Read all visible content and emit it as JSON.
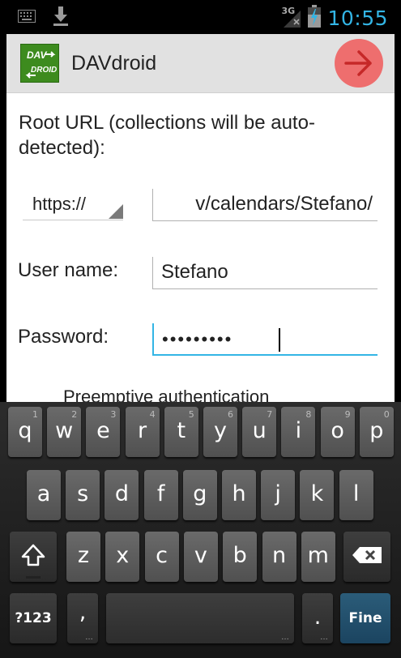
{
  "status_bar": {
    "network_type": "3G",
    "time": "10:55",
    "icons": [
      "keyboard-icon",
      "download-icon",
      "signal-icon",
      "battery-charging-icon"
    ]
  },
  "action_bar": {
    "logo_text_top": "DAV",
    "logo_text_bottom": "DROID",
    "title": "DAVdroid",
    "next_icon": "arrow-right-icon"
  },
  "form": {
    "root_url_label": "Root URL (collections will be auto-detected):",
    "protocol": "https://",
    "url_value": "v/calendars/Stefano/",
    "username_label": "User name:",
    "username_value": "Stefano",
    "password_label": "Password:",
    "password_value": "•••••••••",
    "preemptive_label": "Preemptive authentication"
  },
  "keyboard": {
    "row1": [
      {
        "k": "q",
        "h": "1"
      },
      {
        "k": "w",
        "h": "2"
      },
      {
        "k": "e",
        "h": "3"
      },
      {
        "k": "r",
        "h": "4"
      },
      {
        "k": "t",
        "h": "5"
      },
      {
        "k": "y",
        "h": "6"
      },
      {
        "k": "u",
        "h": "7"
      },
      {
        "k": "i",
        "h": "8"
      },
      {
        "k": "o",
        "h": "9"
      },
      {
        "k": "p",
        "h": "0"
      }
    ],
    "row2": [
      "a",
      "s",
      "d",
      "f",
      "g",
      "h",
      "j",
      "k",
      "l"
    ],
    "row3": [
      "z",
      "x",
      "c",
      "v",
      "b",
      "n",
      "m"
    ],
    "symbols_label": "?123",
    "comma": ",",
    "period": ".",
    "done_label": "Fine"
  },
  "colors": {
    "accent_blue": "#33b5e5",
    "next_button": "#ee6e6e",
    "logo_green": "#3d8b1e"
  }
}
